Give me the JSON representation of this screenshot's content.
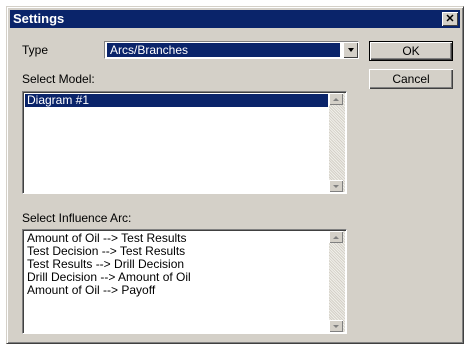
{
  "window": {
    "title": "Settings",
    "close_glyph": "✕"
  },
  "type_field": {
    "label": "Type",
    "value": "Arcs/Branches"
  },
  "buttons": {
    "ok": "OK",
    "cancel": "Cancel"
  },
  "model_list": {
    "label": "Select Model:",
    "items": [
      "Diagram #1"
    ],
    "selected_index": 0
  },
  "arc_list": {
    "label": "Select Influence Arc:",
    "items": [
      "Amount of Oil --> Test Results",
      "Test Decision --> Test Results",
      "Test Results --> Drill Decision",
      "Drill Decision --> Amount of Oil",
      "Amount of Oil --> Payoff"
    ]
  },
  "colors": {
    "face": "#d4d0c8",
    "selection": "#0a246a",
    "titlebar": "#0a246a"
  }
}
